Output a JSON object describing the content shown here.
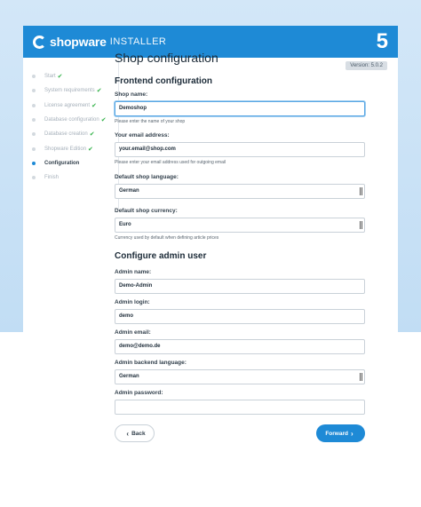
{
  "header": {
    "brand": "shopware",
    "subtitle": "INSTALLER",
    "version_number": "5",
    "version_badge": "Version: 5.0.2"
  },
  "sidebar": {
    "steps": [
      {
        "label": "Start",
        "done": true
      },
      {
        "label": "System requirements",
        "done": true
      },
      {
        "label": "License agreement",
        "done": true
      },
      {
        "label": "Database configuration",
        "done": true
      },
      {
        "label": "Database creation",
        "done": true
      },
      {
        "label": "Shopware Edition",
        "done": true
      },
      {
        "label": "Configuration",
        "done": false,
        "active": true
      },
      {
        "label": "Finish",
        "done": false
      }
    ],
    "check_glyph": "✔"
  },
  "main": {
    "title": "Shop configuration",
    "frontend": {
      "heading": "Frontend configuration",
      "shop_name": {
        "label": "Shop name:",
        "value": "Demoshop",
        "help": "Please enter the name of your shop"
      },
      "email": {
        "label": "Your email address:",
        "value": "your.email@shop.com",
        "help": "Please enter your email address used for outgoing email"
      },
      "language": {
        "label": "Default shop language:",
        "value": "German"
      },
      "currency": {
        "label": "Default shop currency:",
        "value": "Euro",
        "help": "Currency used by default when defining article prices"
      }
    },
    "admin": {
      "heading": "Configure admin user",
      "name": {
        "label": "Admin name:",
        "value": "Demo-Admin"
      },
      "login": {
        "label": "Admin login:",
        "value": "demo"
      },
      "email": {
        "label": "Admin email:",
        "value": "demo@demo.de"
      },
      "backend_language": {
        "label": "Admin backend language:",
        "value": "German"
      },
      "password": {
        "label": "Admin password:",
        "value": ""
      }
    }
  },
  "buttons": {
    "back": "Back",
    "forward": "Forward"
  },
  "colors": {
    "accent": "#1e8ad6",
    "success": "#34b24a",
    "background": "#c8e1f6"
  }
}
